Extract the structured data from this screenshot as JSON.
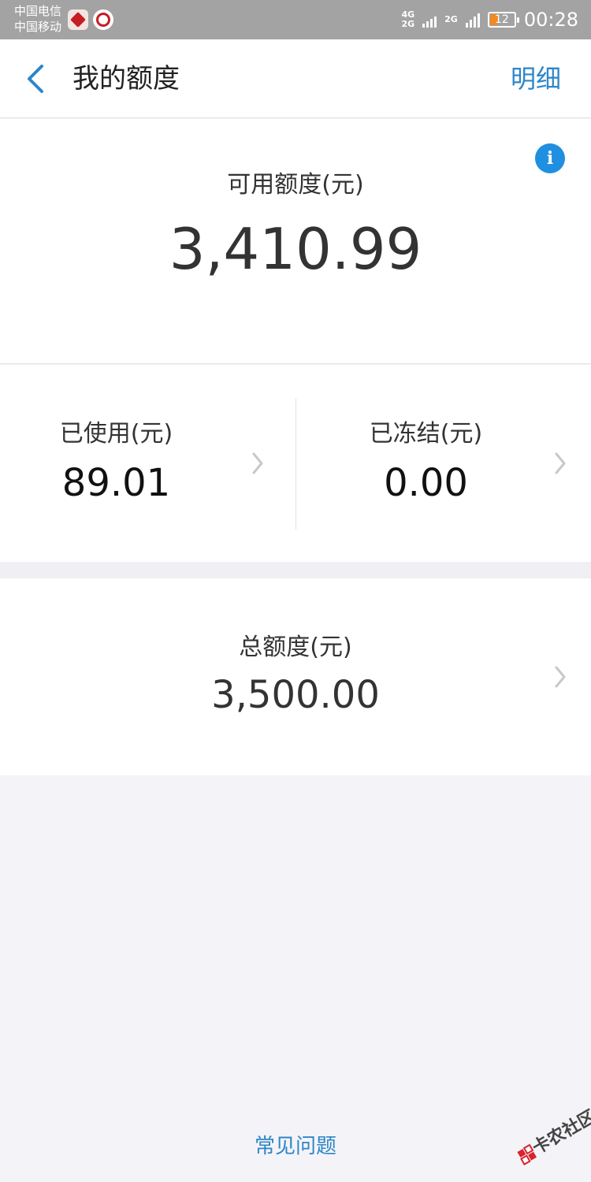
{
  "status_bar": {
    "carrier_1": "中国电信",
    "carrier_2": "中国移动",
    "network_1": "4G",
    "network_2": "2G",
    "network_3": "2G",
    "battery_level": "12",
    "time": "00:28",
    "battery_color": "#f08a24"
  },
  "header": {
    "title": "我的额度",
    "detail_label": "明细",
    "accent_color": "#2e86c9"
  },
  "available": {
    "label": "可用额度(元)",
    "value": "3,410.99"
  },
  "used": {
    "label": "已使用(元)",
    "value": "89.01"
  },
  "frozen": {
    "label": "已冻结(元)",
    "value": "0.00"
  },
  "total": {
    "label": "总额度(元)",
    "value": "3,500.00"
  },
  "footer": {
    "faq_label": "常见问题"
  },
  "watermark": {
    "text": "卡农社区"
  }
}
